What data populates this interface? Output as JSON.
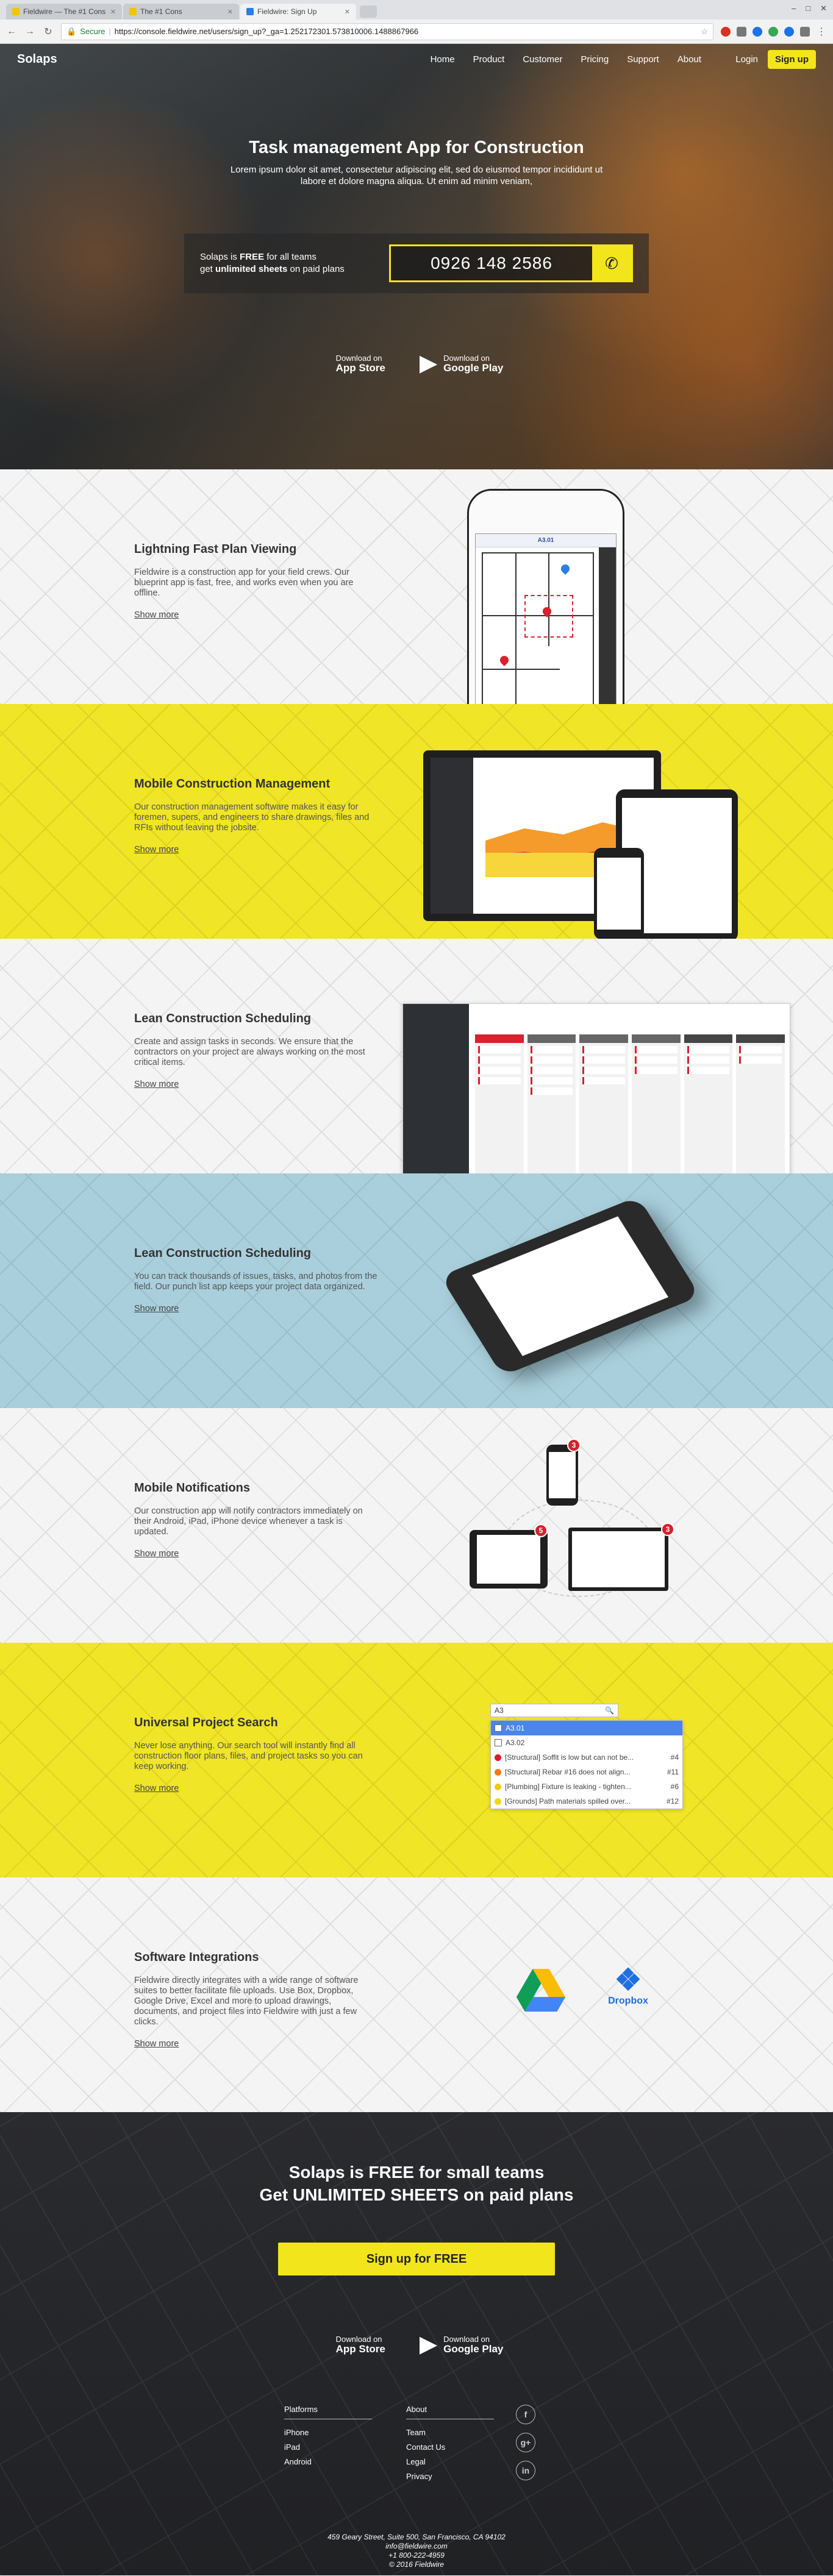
{
  "browser": {
    "tabs": [
      {
        "title": "Fieldwire — The #1 Cons"
      },
      {
        "title": "The #1 Cons"
      },
      {
        "title": "Fieldwire: Sign Up"
      }
    ],
    "window_controls": [
      "–",
      "□",
      "✕"
    ],
    "secure_label": "Secure",
    "url": "https://console.fieldwire.net/users/sign_up?_ga=1.252172301.573810006.1488867966"
  },
  "nav": {
    "logo": "Solaps",
    "menu": [
      "Home",
      "Product",
      "Customer",
      "Pricing",
      "Support",
      "About"
    ],
    "login": "Login",
    "signup": "Sign up"
  },
  "hero": {
    "title": "Task management App for Construction",
    "subtitle": "Lorem ipsum dolor sit amet, consectetur adipiscing elit, sed do eiusmod tempor incididunt ut labore et dolore magna aliqua. Ut enim ad minim veniam,",
    "free_line1_pre": "Solaps is ",
    "free_line1_bold": "FREE",
    "free_line1_post": " for all teams",
    "free_line2_pre": "get ",
    "free_line2_bold": "unlimited sheets",
    "free_line2_post": " on paid plans",
    "phone": "0926 148 2586"
  },
  "stores": {
    "appstore_small": "Download on",
    "appstore_big": "App Store",
    "play_small": "Download on",
    "play_big": "Google Play"
  },
  "features": [
    {
      "title": "Lightning Fast Plan Viewing",
      "text": "Fieldwire is a construction app for your field crews. Our blueprint app is fast, free, and works even when you are offline.",
      "more": "Show more"
    },
    {
      "title": "Mobile Construction Management",
      "text": "Our construction management software makes it easy for foremen, supers, and engineers to share drawings, files and RFIs without leaving the jobsite.",
      "more": "Show more"
    },
    {
      "title": "Lean Construction Scheduling",
      "text": "Create and assign tasks in seconds. We ensure that the contractors on your project are always working on the most critical items.",
      "more": "Show more"
    },
    {
      "title": "Lean Construction Scheduling",
      "text": "You can track thousands of issues, tasks, and photos from the field. Our punch list app keeps your project data organized.",
      "more": "Show more"
    },
    {
      "title": "Mobile Notifications",
      "text": "Our construction app will notify contractors immediately on their Android, iPad, iPhone device whenever a task is updated.",
      "more": "Show more"
    },
    {
      "title": "Universal Project Search",
      "text": "Never lose anything. Our search tool will instantly find all construction floor plans, files, and project tasks so you can keep working.",
      "more": "Show more"
    },
    {
      "title": "Software Integrations",
      "text": "Fieldwire directly integrates with a wide range of software suites to better facilitate file uploads. Use Box, Dropbox, Google Drive, Excel and more to upload drawings, documents, and project files into Fieldwire with just a few clicks.",
      "more": "Show more"
    }
  ],
  "mockups": {
    "plan_sheet": "A3.01",
    "notification_counts": [
      "3",
      "5",
      "3"
    ],
    "search_query": "A3",
    "search_results": [
      {
        "text": "A3.01",
        "num": "",
        "kind": "sheet",
        "color": "#4a86e8"
      },
      {
        "text": "A3.02",
        "num": "",
        "kind": "sheet",
        "color": "#ffffff"
      },
      {
        "text": "[Structural] Soffit is low but can not be...",
        "num": "#4",
        "kind": "task",
        "color": "#d8202e"
      },
      {
        "text": "[Structural] Rebar #16 does not align...",
        "num": "#11",
        "kind": "task",
        "color": "#f07a1a"
      },
      {
        "text": "[Plumbing] Fixture is leaking - tighten...",
        "num": "#6",
        "kind": "task",
        "color": "#f3c71c"
      },
      {
        "text": "[Grounds] Path materials spilled over...",
        "num": "#12",
        "kind": "task",
        "color": "#f3d51c"
      }
    ],
    "dropbox_label": "Dropbox"
  },
  "cta": {
    "line1": "Solaps is FREE for small teams",
    "line2": "Get UNLIMITED SHEETS on paid plans",
    "button": "Sign up for FREE"
  },
  "footer": {
    "platforms_title": "Platforms",
    "platforms": [
      "iPhone",
      "iPad",
      "Android"
    ],
    "about_title": "About",
    "about": [
      "Team",
      "Contact Us",
      "Legal",
      "Privacy"
    ],
    "social": [
      "f",
      "g+",
      "in"
    ],
    "address": "459 Geary Street, Suite 500, San Francisco, CA 94102",
    "email": "info@fieldwire.com",
    "phone": "+1 800-222-4959",
    "copyright": "© 2016 Fieldwire"
  },
  "colors": {
    "accent_yellow": "#f2e51b",
    "section_yellow": "#f0e526",
    "section_blue": "#a9cfdc",
    "footer_dark": "#252629"
  }
}
